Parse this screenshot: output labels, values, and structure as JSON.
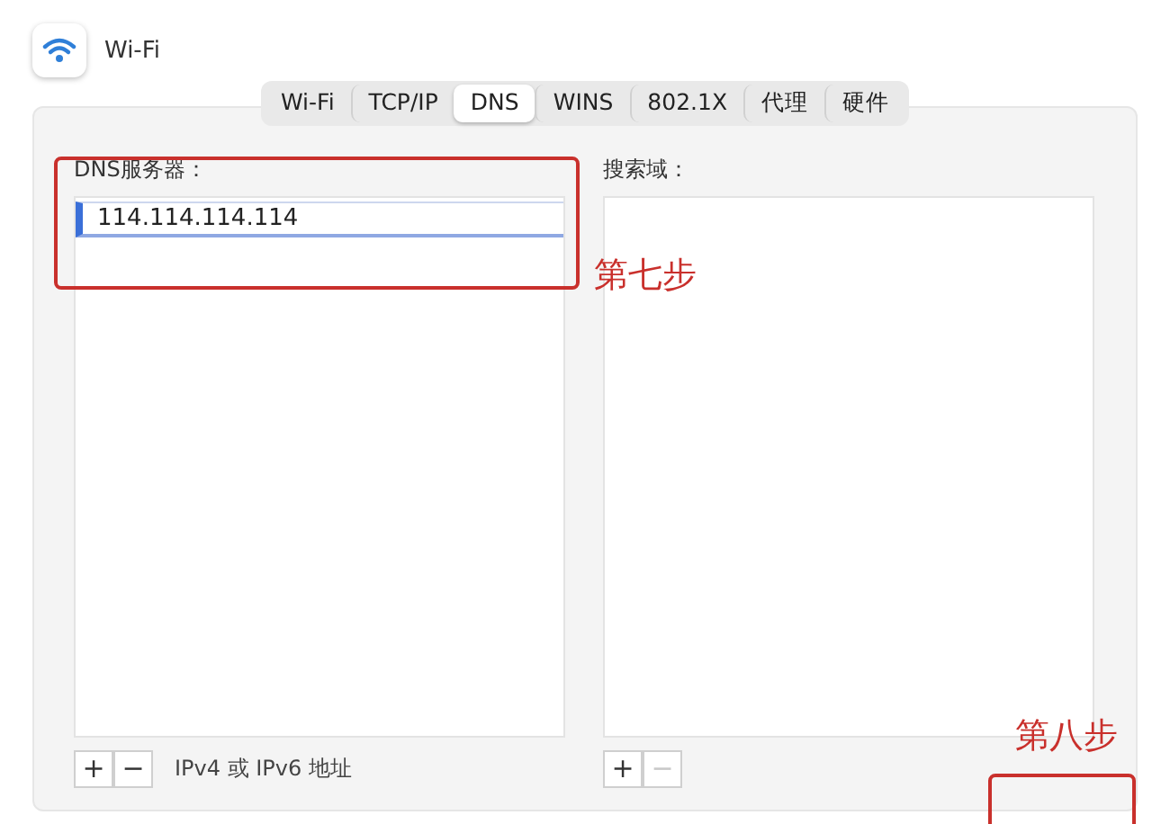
{
  "window": {
    "title": "Wi-Fi"
  },
  "tabs": [
    {
      "label": "Wi-Fi",
      "selected": false
    },
    {
      "label": "TCP/IP",
      "selected": false
    },
    {
      "label": "DNS",
      "selected": true
    },
    {
      "label": "WINS",
      "selected": false
    },
    {
      "label": "802.1X",
      "selected": false
    },
    {
      "label": "代理",
      "selected": false
    },
    {
      "label": "硬件",
      "selected": false
    }
  ],
  "dns_servers": {
    "label": "DNS服务器：",
    "entries": [
      {
        "value": "114.114.114.114",
        "selected": true
      }
    ],
    "add": "+",
    "remove": "−",
    "remove_disabled": false,
    "hint": "IPv4 或 IPv6 地址"
  },
  "search_domains": {
    "label": "搜索域：",
    "add": "+",
    "remove": "−",
    "remove_disabled": true
  },
  "annotations": {
    "step_servers": "第七步",
    "step_ok": "第八步"
  }
}
